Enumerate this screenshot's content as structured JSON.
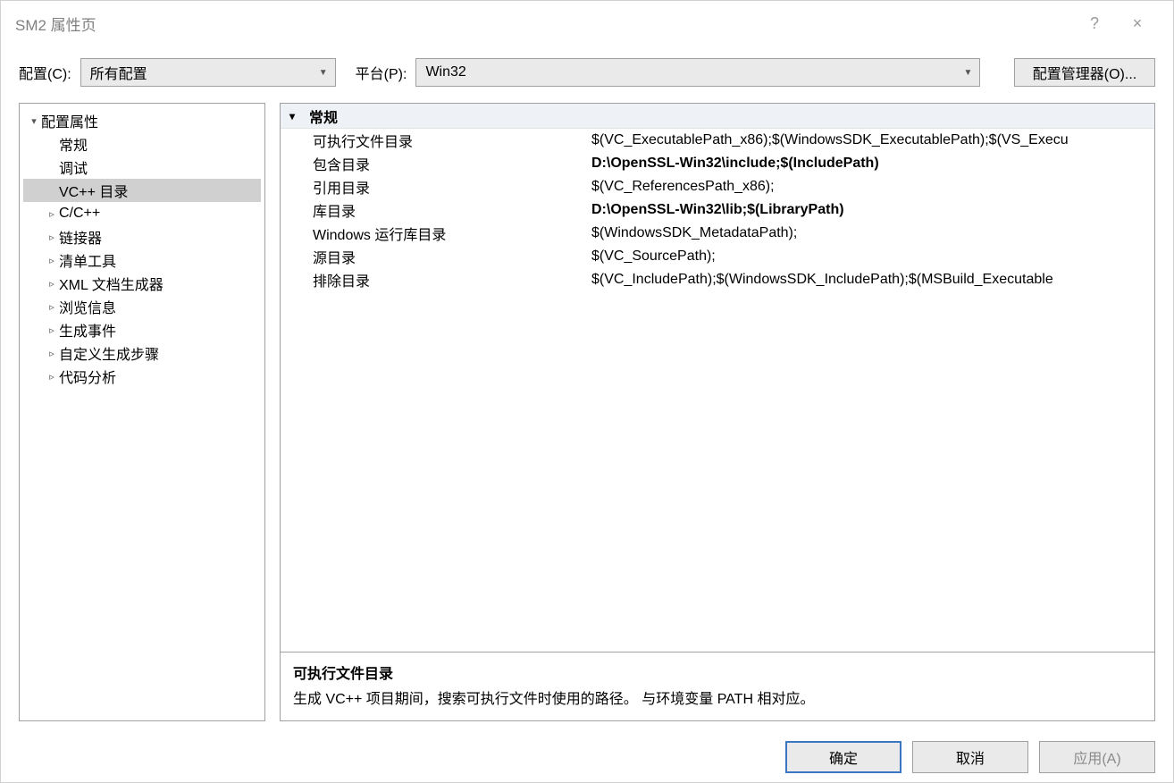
{
  "titlebar": {
    "title": "SM2 属性页",
    "help": "?",
    "close": "×"
  },
  "toolbar": {
    "config_label": "配置(C):",
    "config_value": "所有配置",
    "platform_label": "平台(P):",
    "platform_value": "Win32",
    "manager_label": "配置管理器(O)..."
  },
  "tree": {
    "root": "配置属性",
    "items": [
      {
        "label": "常规",
        "expandable": false
      },
      {
        "label": "调试",
        "expandable": false
      },
      {
        "label": "VC++ 目录",
        "expandable": false,
        "selected": true
      },
      {
        "label": "C/C++",
        "expandable": true
      },
      {
        "label": "链接器",
        "expandable": true
      },
      {
        "label": "清单工具",
        "expandable": true
      },
      {
        "label": "XML 文档生成器",
        "expandable": true
      },
      {
        "label": "浏览信息",
        "expandable": true
      },
      {
        "label": "生成事件",
        "expandable": true
      },
      {
        "label": "自定义生成步骤",
        "expandable": true
      },
      {
        "label": "代码分析",
        "expandable": true
      }
    ]
  },
  "grid": {
    "section": "常规",
    "rows": [
      {
        "k": "可执行文件目录",
        "v": "$(VC_ExecutablePath_x86);$(WindowsSDK_ExecutablePath);$(VS_Execu",
        "bold": false
      },
      {
        "k": "包含目录",
        "v": "D:\\OpenSSL-Win32\\include;$(IncludePath)",
        "bold": true
      },
      {
        "k": "引用目录",
        "v": "$(VC_ReferencesPath_x86);",
        "bold": false
      },
      {
        "k": "库目录",
        "v": "D:\\OpenSSL-Win32\\lib;$(LibraryPath)",
        "bold": true
      },
      {
        "k": "Windows 运行库目录",
        "v": "$(WindowsSDK_MetadataPath);",
        "bold": false
      },
      {
        "k": "源目录",
        "v": "$(VC_SourcePath);",
        "bold": false
      },
      {
        "k": "排除目录",
        "v": "$(VC_IncludePath);$(WindowsSDK_IncludePath);$(MSBuild_Executable",
        "bold": false
      }
    ]
  },
  "description": {
    "title": "可执行文件目录",
    "text": "生成 VC++ 项目期间，搜索可执行文件时使用的路径。 与环境变量 PATH 相对应。"
  },
  "footer": {
    "ok": "确定",
    "cancel": "取消",
    "apply": "应用(A)"
  }
}
